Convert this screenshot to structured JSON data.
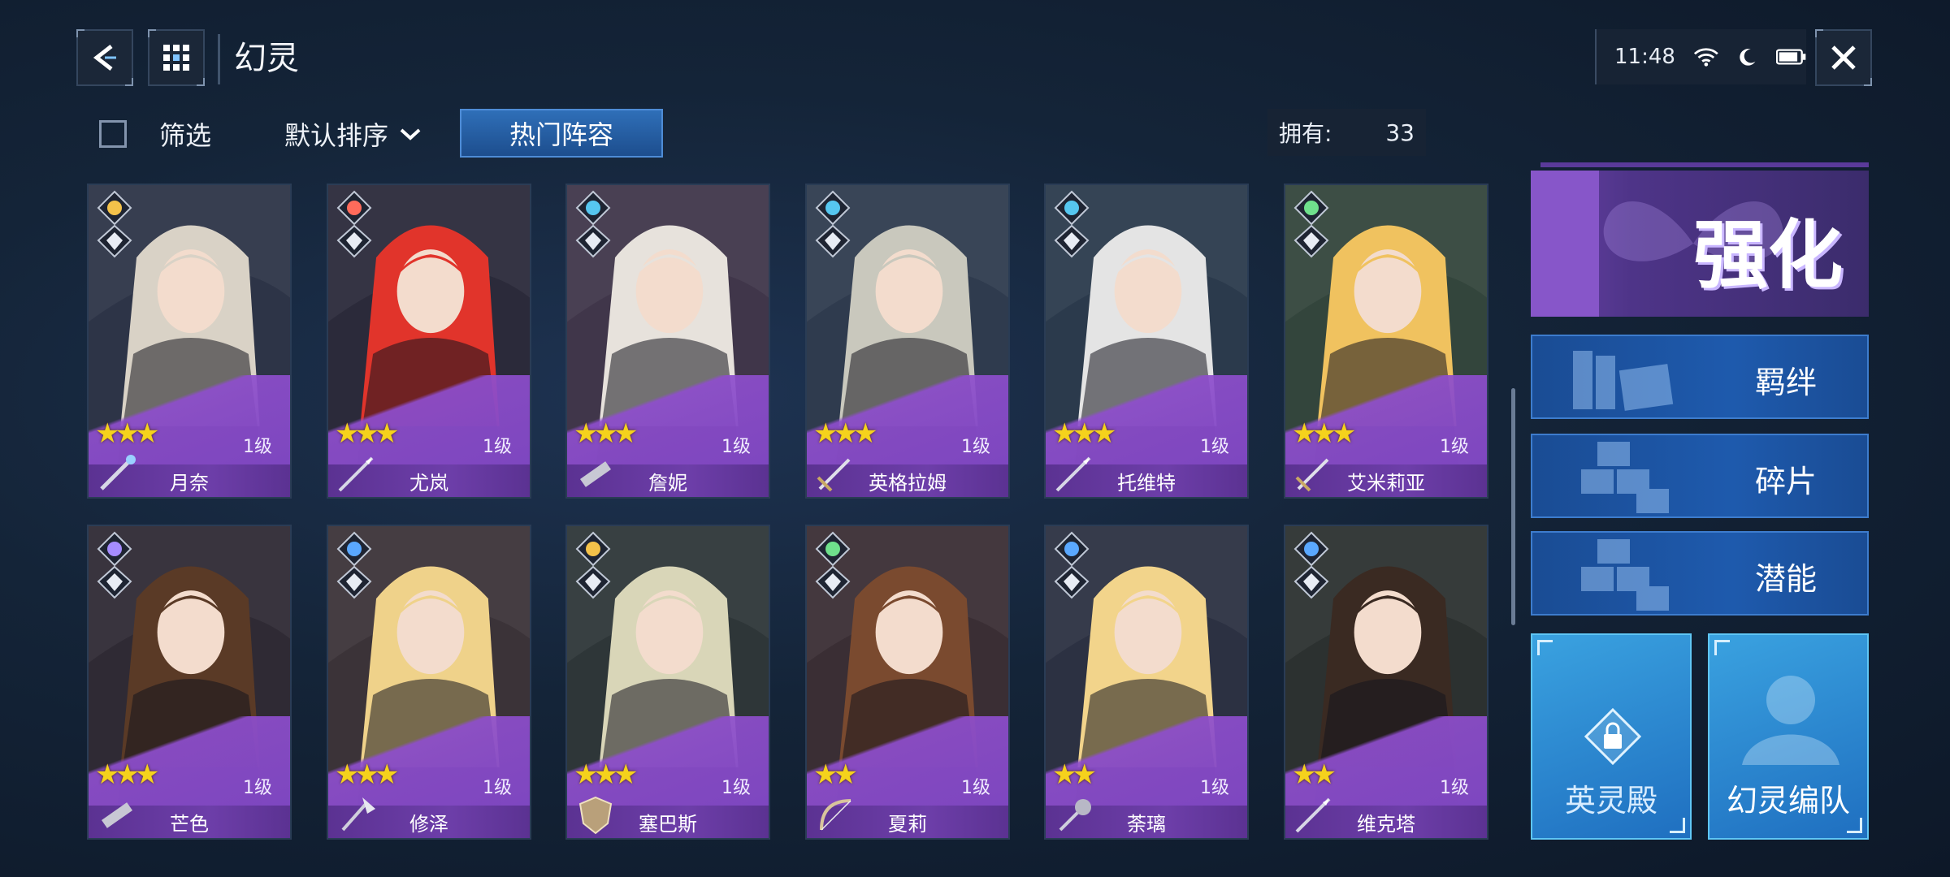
{
  "header": {
    "title": "幻灵",
    "status": {
      "time": "11:48"
    }
  },
  "filter": {
    "filter_label": "筛选",
    "sort_label": "默认排序",
    "hot_label": "热门阵容",
    "owned_label": "拥有:",
    "owned_count": "33"
  },
  "cards": [
    {
      "name": "月奈",
      "level": "1级",
      "stars": "★★★",
      "element_color": "#f4c24a",
      "weapon": "wand-icon",
      "hair": "#d9d2c6",
      "bg": "#2d3447"
    },
    {
      "name": "尤岚",
      "level": "1级",
      "stars": "★★★",
      "element_color": "#ff6b5b",
      "weapon": "spear-icon",
      "hair": "#e1342b",
      "bg": "#2b2a3a"
    },
    {
      "name": "詹妮",
      "level": "1级",
      "stars": "★★★",
      "element_color": "#56c7f0",
      "weapon": "gun-icon",
      "hair": "#e7e2dc",
      "bg": "#40364a"
    },
    {
      "name": "英格拉姆",
      "level": "1级",
      "stars": "★★★",
      "element_color": "#56c7f0",
      "weapon": "sword-icon",
      "hair": "#c9c8bd",
      "bg": "#2f3b4e"
    },
    {
      "name": "托维特",
      "level": "1级",
      "stars": "★★★",
      "element_color": "#56c7f0",
      "weapon": "spear-icon",
      "hair": "#e4e4e4",
      "bg": "#2b3a4c"
    },
    {
      "name": "艾米莉亚",
      "level": "1级",
      "stars": "★★★",
      "element_color": "#6fe08c",
      "weapon": "sword-icon",
      "hair": "#f0c25f",
      "bg": "#33453c"
    },
    {
      "name": "芒色",
      "level": "1级",
      "stars": "★★★",
      "element_color": "#a58cff",
      "weapon": "gun-icon",
      "hair": "#5a3a26",
      "bg": "#2f2a34"
    },
    {
      "name": "修泽",
      "level": "1级",
      "stars": "★★★",
      "element_color": "#5aa8ff",
      "weapon": "axe-icon",
      "hair": "#efd28a",
      "bg": "#3b3338"
    },
    {
      "name": "塞巴斯",
      "level": "1级",
      "stars": "★★★",
      "element_color": "#f4c24a",
      "weapon": "shield-icon",
      "hair": "#d9d6b8",
      "bg": "#2e3638"
    },
    {
      "name": "夏莉",
      "level": "1级",
      "stars": "★★",
      "element_color": "#6fe08c",
      "weapon": "bow-icon",
      "hair": "#7a4a2f",
      "bg": "#3a2e34"
    },
    {
      "name": "荼璃",
      "level": "1级",
      "stars": "★★",
      "element_color": "#5aa8ff",
      "weapon": "mace-icon",
      "hair": "#f2d48b",
      "bg": "#2c3142"
    },
    {
      "name": "维克塔",
      "level": "1级",
      "stars": "★★",
      "element_color": "#5aa8ff",
      "weapon": "spear-icon",
      "hair": "#3a2a22",
      "bg": "#2c3130"
    }
  ],
  "right_panel": {
    "enhance_label": "强化",
    "bond_label": "羁绊",
    "fragment_label": "碎片",
    "potential_label": "潜能",
    "hall_label": "英灵殿",
    "team_label": "幻灵编队"
  },
  "colors": {
    "accent_blue": "#1e5aad",
    "card_purple": "#7b45bf",
    "star_yellow": "#f5d21c"
  }
}
